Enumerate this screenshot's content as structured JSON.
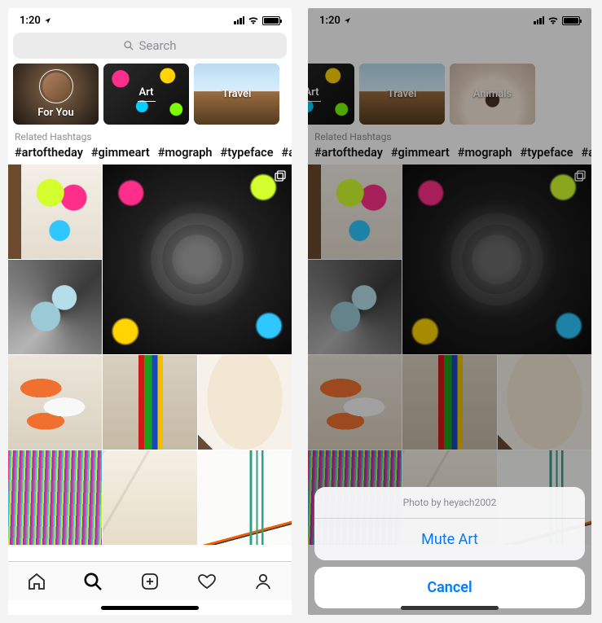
{
  "status": {
    "time": "1:20"
  },
  "search": {
    "placeholder": "Search"
  },
  "left": {
    "categories": [
      {
        "name": "for-you",
        "label": "For You",
        "avatar": true
      },
      {
        "name": "art",
        "label": "Art",
        "active": true
      },
      {
        "name": "travel",
        "label": "Travel"
      }
    ]
  },
  "right": {
    "categories": [
      {
        "name": "art",
        "label": "Art",
        "active": true
      },
      {
        "name": "travel",
        "label": "Travel"
      },
      {
        "name": "animals",
        "label": "Animals"
      }
    ]
  },
  "related": {
    "label": "Related Hashtags",
    "tags": [
      "#artoftheday",
      "#gimmeart",
      "#mograph",
      "#typeface",
      "#artis"
    ]
  },
  "sheet": {
    "title": "Photo by heyach2002",
    "mute": "Mute Art",
    "cancel": "Cancel"
  }
}
